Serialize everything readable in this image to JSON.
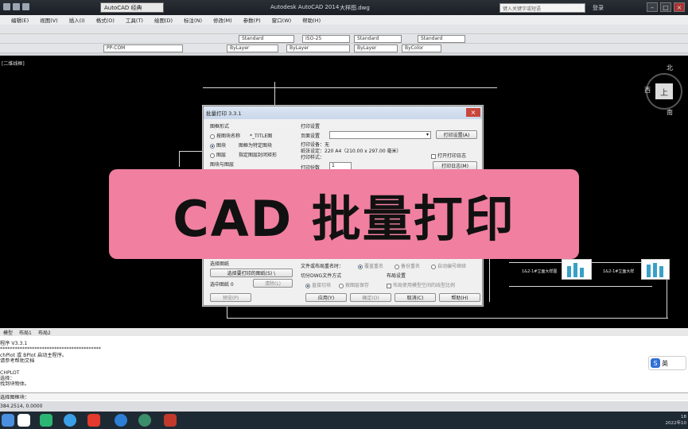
{
  "window": {
    "workspace": "AutoCAD 经典",
    "app_title": "Autodesk AutoCAD 2014",
    "file_name": "大样图.dwg",
    "search_placeholder": "键入关键字或短语",
    "login": "登录"
  },
  "menu": [
    "编辑(E)",
    "视图(V)",
    "插入(I)",
    "格式(O)",
    "工具(T)",
    "绘图(D)",
    "标注(N)",
    "修改(M)",
    "参数(P)",
    "窗口(W)",
    "帮助(H)"
  ],
  "toolbar": {
    "text_style": "Standard",
    "dim_style": "ISO-25",
    "table_style": "Standard",
    "mleader_style": "Standard",
    "layer": "PP-COM",
    "color": "ByLayer",
    "linetype": "ByLayer",
    "lineweight": "ByLayer",
    "plotstyle": "ByColor"
  },
  "viewport_label": "[二维线框]",
  "viewcube": {
    "north": "北",
    "west": "西",
    "top": "上",
    "south": "南"
  },
  "thumb_labels": [
    "1&2-1#立面大样图",
    "1&2-1#立面大样"
  ],
  "dialog": {
    "title": "批量打印 3.3.1",
    "frame_group": "图框形式",
    "opt_block_by_name": "按图块名称",
    "opt_block_by_name_value": "*_TITLE图",
    "opt_block": "图块",
    "opt_block_desc": "图框为特定图块",
    "opt_layer": "图层",
    "opt_layer_desc": "指定图层封闭矩形",
    "frame_sep": "图块与图层",
    "print_group": "打印设置",
    "page_setup_label": "页面设置",
    "page_setup_button": "打印设置(A)",
    "device": "打印设备：无",
    "paper": "纸张设定：220 A4（210.00 x 297.00 毫米）",
    "plot_style": "打印样式：",
    "copies_label": "打印份数",
    "copies_value": "1",
    "open_log": "打开打印日志",
    "log_button": "打印日志(M)",
    "select_group": "选择图纸",
    "select_button": "选择要打印的图纸(S) \\",
    "selected": "选中图纸 0",
    "clear_button": "清除(L)",
    "filename_label": "文件或布局重名时：",
    "opt_overwrite": "覆盖重名",
    "opt_backup": "备份重名",
    "opt_autonum": "自动编号继续",
    "split_label": "切分DWG文件方式",
    "layout_group": "布局设置",
    "split_opt1": "直接切块",
    "split_opt2": "按图层保存",
    "layout_opt": "布局使用模型空间的线型比例",
    "preview_button": "预览(P)",
    "apply_button": "应用(Y)",
    "ok_button": "确定(O)",
    "cancel_button": "取消(C)",
    "help_button": "帮助(H)"
  },
  "banner": "CAD 批量打印",
  "tabs": [
    "模型",
    "布局1",
    "布局2"
  ],
  "command_lines": [
    "程序 V3.3.1",
    "*****************************************",
    "chPlot 或 BPlot 启动主程序。",
    "请参考帮助文档",
    "",
    "CHPLOT",
    "选择：",
    "找到块物体。"
  ],
  "command_prompt": "选择图框块：",
  "status_coords": "384.2514, 0.0000",
  "ime": {
    "logo": "S",
    "lang": "英"
  },
  "clock": {
    "time": "18",
    "date": "2022年10"
  }
}
